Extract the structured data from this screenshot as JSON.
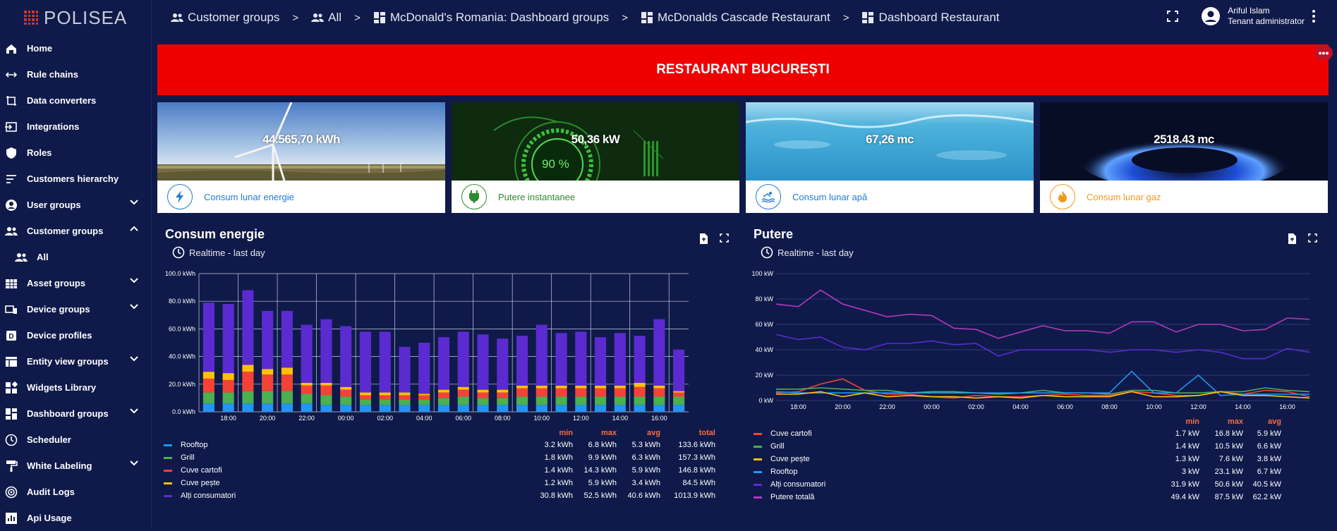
{
  "logo": {
    "text": "POLISEA"
  },
  "sidebar": {
    "items": [
      {
        "label": "Home",
        "icon": "home-icon"
      },
      {
        "label": "Rule chains",
        "icon": "rule-chains-icon"
      },
      {
        "label": "Data converters",
        "icon": "data-converters-icon"
      },
      {
        "label": "Integrations",
        "icon": "integrations-icon"
      },
      {
        "label": "Roles",
        "icon": "roles-shield-icon"
      },
      {
        "label": "Customers hierarchy",
        "icon": "hierarchy-icon"
      },
      {
        "label": "User groups",
        "icon": "user-groups-icon"
      },
      {
        "label": "Customer groups",
        "icon": "customer-groups-icon"
      },
      {
        "label": "All",
        "icon": "all-group-icon"
      },
      {
        "label": "Asset groups",
        "icon": "asset-groups-icon"
      },
      {
        "label": "Device groups",
        "icon": "device-groups-icon"
      },
      {
        "label": "Device profiles",
        "icon": "device-profiles-icon"
      },
      {
        "label": "Entity view groups",
        "icon": "entity-view-icon"
      },
      {
        "label": "Widgets Library",
        "icon": "widgets-icon"
      },
      {
        "label": "Dashboard groups",
        "icon": "dashboard-groups-icon"
      },
      {
        "label": "Scheduler",
        "icon": "clock-icon"
      },
      {
        "label": "White Labeling",
        "icon": "paint-roller-icon"
      },
      {
        "label": "Audit Logs",
        "icon": "audit-logs-icon"
      },
      {
        "label": "Api Usage",
        "icon": "api-usage-icon"
      }
    ]
  },
  "breadcrumb": {
    "items": [
      "Customer groups",
      "All",
      "McDonald's Romania: Dashboard groups",
      "McDonalds Cascade Restaurant",
      "Dashboard Restaurant"
    ],
    "separator": ">"
  },
  "user": {
    "name": "Ariful Islam",
    "role": "Tenant administrator"
  },
  "banner": {
    "title": "RESTAURANT BUCUREȘTI",
    "menu": "•••",
    "color": "#ef0000"
  },
  "cards": [
    {
      "value": "44.565,70 kWh",
      "label": "Consum lunar energie",
      "color": "#1f7ad6",
      "icon": "lightning-icon"
    },
    {
      "value": "50,36 kW",
      "label": "Putere instantanee",
      "color": "#2e8b2e",
      "icon": "plug-icon",
      "gauge": "90 %"
    },
    {
      "value": "67,26 mc",
      "label": "Consum lunar apă",
      "color": "#1f7ad6",
      "icon": "swimming-icon"
    },
    {
      "value": "2518.43 mc",
      "label": "Consum lunar gaz",
      "color": "#f09a1a",
      "icon": "flame-icon"
    }
  ],
  "energy_panel": {
    "title": "Consum energie",
    "timewindow": "Realtime - last day",
    "legend_headers": [
      "min",
      "max",
      "avg",
      "total"
    ],
    "legend": [
      {
        "name": "Rooftop",
        "color": "#2196f3",
        "min": "3.2 kWh",
        "max": "6.8 kWh",
        "avg": "5.3 kWh",
        "total": "133.6 kWh"
      },
      {
        "name": "Grill",
        "color": "#4caf50",
        "min": "1.8 kWh",
        "max": "9.9 kWh",
        "avg": "6.3 kWh",
        "total": "157.3 kWh"
      },
      {
        "name": "Cuve cartofi",
        "color": "#f44336",
        "min": "1.4 kWh",
        "max": "14.3 kWh",
        "avg": "5.9 kWh",
        "total": "146.8 kWh"
      },
      {
        "name": "Cuve pește",
        "color": "#ffc107",
        "min": "1.2 kWh",
        "max": "5.9 kWh",
        "avg": "3.4 kWh",
        "total": "84.5 kWh"
      },
      {
        "name": "Alți consumatori",
        "color": "#5b2bd1",
        "min": "30.8 kWh",
        "max": "52.5 kWh",
        "avg": "40.6 kWh",
        "total": "1013.9 kWh"
      }
    ]
  },
  "power_panel": {
    "title": "Putere",
    "timewindow": "Realtime - last day",
    "legend_headers": [
      "min",
      "max",
      "avg"
    ],
    "legend": [
      {
        "name": "Cuve cartofi",
        "color": "#f44336",
        "min": "1.7 kW",
        "max": "16.8 kW",
        "avg": "5.9 kW"
      },
      {
        "name": "Grill",
        "color": "#4caf50",
        "min": "1.4 kW",
        "max": "10.5 kW",
        "avg": "6.6 kW"
      },
      {
        "name": "Cuve pește",
        "color": "#ffc107",
        "min": "1.3 kW",
        "max": "7.6 kW",
        "avg": "3.8 kW"
      },
      {
        "name": "Rooftop",
        "color": "#2196f3",
        "min": "3 kW",
        "max": "23.1 kW",
        "avg": "6.7 kW"
      },
      {
        "name": "Alți consumatori",
        "color": "#5b2bd1",
        "min": "31.9 kW",
        "max": "50.6 kW",
        "avg": "40.5 kW"
      },
      {
        "name": "Putere totală",
        "color": "#b03ab8",
        "min": "49.4 kW",
        "max": "87.5 kW",
        "avg": "62.2 kW"
      }
    ]
  },
  "chart_data": [
    {
      "type": "bar",
      "stacked": true,
      "title": "Consum energie",
      "ylim": [
        0,
        100
      ],
      "yticks": [
        "0.0 kWh",
        "20.0 kWh",
        "40.0 kWh",
        "60.0 kWh",
        "80.0 kWh",
        "100.0 kWh"
      ],
      "xticks": [
        "18:00",
        "20:00",
        "22:00",
        "00:00",
        "02:00",
        "04:00",
        "06:00",
        "08:00",
        "10:00",
        "12:00",
        "14:00",
        "16:00"
      ],
      "categories": [
        "17:00",
        "18:00",
        "19:00",
        "20:00",
        "21:00",
        "22:00",
        "23:00",
        "00:00",
        "01:00",
        "02:00",
        "03:00",
        "04:00",
        "05:00",
        "06:00",
        "07:00",
        "08:00",
        "09:00",
        "10:00",
        "11:00",
        "12:00",
        "13:00",
        "14:00",
        "15:00",
        "16:00",
        "17:00"
      ],
      "series": [
        {
          "name": "Rooftop",
          "color": "#2196f3",
          "values": [
            6,
            6,
            6,
            6,
            6,
            6,
            5,
            5,
            5,
            5,
            5,
            5,
            5,
            5,
            5,
            5,
            5,
            5,
            5,
            5,
            5,
            5,
            5,
            5,
            5
          ]
        },
        {
          "name": "Grill",
          "color": "#4caf50",
          "values": [
            8,
            8,
            9,
            9,
            9,
            7,
            7,
            6,
            4,
            4,
            4,
            4,
            5,
            6,
            5,
            5,
            6,
            6,
            6,
            6,
            6,
            6,
            6,
            6,
            6
          ]
        },
        {
          "name": "Cuve cartofi",
          "color": "#f44336",
          "values": [
            10,
            9,
            14,
            12,
            12,
            6,
            7,
            5,
            3,
            3,
            3,
            3,
            4,
            5,
            4,
            4,
            6,
            6,
            6,
            6,
            6,
            6,
            7,
            6,
            3
          ]
        },
        {
          "name": "Cuve pește",
          "color": "#ffc107",
          "values": [
            5,
            5,
            5,
            4,
            5,
            2,
            2,
            2,
            2,
            2,
            2,
            1,
            2,
            2,
            2,
            2,
            2,
            2,
            2,
            2,
            2,
            2,
            3,
            2,
            1
          ]
        },
        {
          "name": "Alți consumatori",
          "color": "#5b2bd1",
          "values": [
            50,
            50,
            54,
            42,
            41,
            42,
            46,
            44,
            44,
            44,
            33,
            37,
            38,
            40,
            40,
            37,
            36,
            44,
            38,
            39,
            35,
            38,
            34,
            48,
            30
          ]
        }
      ]
    },
    {
      "type": "line",
      "title": "Putere",
      "ylim": [
        0,
        100
      ],
      "yticks": [
        "0 kW",
        "20 kW",
        "40 kW",
        "60 kW",
        "80 kW",
        "100 kW"
      ],
      "xticks": [
        "18:00",
        "20:00",
        "22:00",
        "00:00",
        "02:00",
        "04:00",
        "06:00",
        "08:00",
        "10:00",
        "12:00",
        "14:00",
        "16:00"
      ],
      "x": [
        17,
        18,
        19,
        20,
        21,
        22,
        23,
        24,
        25,
        26,
        27,
        28,
        29,
        30,
        31,
        32,
        33,
        34,
        35,
        36,
        37,
        38,
        39,
        40,
        41
      ],
      "series": [
        {
          "name": "Putere totală",
          "color": "#b03ab8",
          "values": [
            76,
            74,
            87,
            76,
            71,
            66,
            68,
            67,
            57,
            56,
            49,
            54,
            59,
            55,
            55,
            53,
            62,
            62,
            54,
            60,
            60,
            55,
            56,
            65,
            64
          ]
        },
        {
          "name": "Alți consumatori",
          "color": "#5b2bd1",
          "values": [
            52,
            48,
            50,
            42,
            40,
            45,
            45,
            47,
            44,
            45,
            35,
            40,
            40,
            40,
            40,
            38,
            40,
            40,
            38,
            40,
            38,
            33,
            33,
            41,
            38
          ]
        },
        {
          "name": "Cuve cartofi",
          "color": "#f44336",
          "values": [
            6,
            7,
            13,
            17,
            8,
            5,
            5,
            3,
            2,
            4,
            3,
            3,
            4,
            5,
            4,
            4,
            7,
            6,
            4,
            4,
            7,
            5,
            8,
            7,
            3
          ]
        },
        {
          "name": "Grill",
          "color": "#4caf50",
          "values": [
            9,
            9,
            10,
            9,
            8,
            8,
            6,
            7,
            7,
            6,
            5,
            6,
            8,
            6,
            6,
            5,
            8,
            8,
            6,
            6,
            7,
            7,
            10,
            8,
            7
          ]
        },
        {
          "name": "Rooftop",
          "color": "#2196f3",
          "values": [
            7,
            6,
            6,
            6,
            6,
            6,
            6,
            6,
            6,
            6,
            6,
            6,
            6,
            6,
            6,
            6,
            23,
            6,
            6,
            20,
            4,
            5,
            5,
            5,
            5
          ]
        },
        {
          "name": "Cuve pește",
          "color": "#ffc107",
          "values": [
            5,
            5,
            7,
            3,
            6,
            3,
            4,
            3,
            3,
            2,
            3,
            2,
            4,
            3,
            3,
            3,
            7,
            3,
            3,
            4,
            7,
            4,
            4,
            3,
            2
          ]
        }
      ]
    }
  ]
}
